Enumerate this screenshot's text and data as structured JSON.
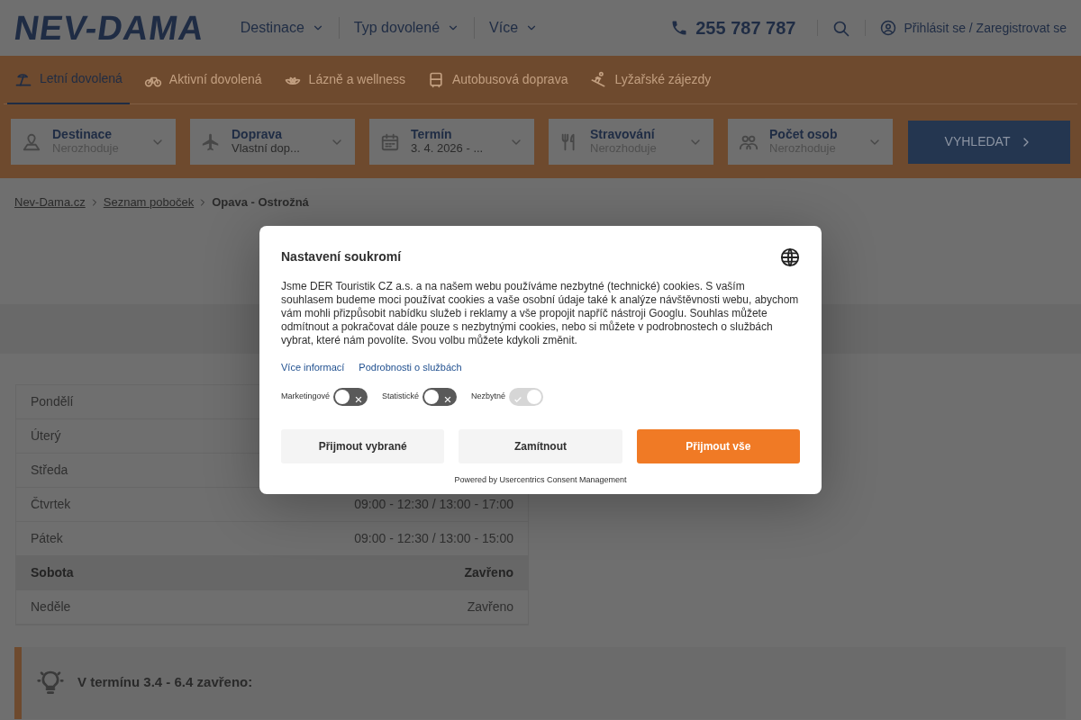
{
  "header": {
    "logo": "NEV-DAMA",
    "nav": [
      {
        "label": "Destinace"
      },
      {
        "label": "Typ dovolené"
      },
      {
        "label": "Více"
      }
    ],
    "phone": "255 787 787",
    "login": "Přihlásit se / Zaregistrovat se"
  },
  "category_tabs": [
    {
      "label": "Letní dovolená",
      "selected": true
    },
    {
      "label": "Aktivní dovolená",
      "selected": false
    },
    {
      "label": "Lázně a wellness",
      "selected": false
    },
    {
      "label": "Autobusová doprava",
      "selected": false
    },
    {
      "label": "Lyžařské zájezdy",
      "selected": false
    }
  ],
  "search_fields": [
    {
      "label": "Destinace",
      "placeholder": "Nerozhoduje"
    },
    {
      "label": "Doprava",
      "value": "Vlastní dop..."
    },
    {
      "label": "Termín",
      "value": "3. 4. 2026 - ..."
    },
    {
      "label": "Stravování",
      "placeholder": "Nerozhoduje"
    },
    {
      "label": "Počet osob",
      "placeholder": "Nerozhoduje"
    }
  ],
  "search_button": "VYHLEDAT",
  "breadcrumb": [
    {
      "label": "Nev-Dama.cz",
      "current": false
    },
    {
      "label": "Seznam poboček",
      "current": false
    },
    {
      "label": "Opava - Ostrožná",
      "current": true
    }
  ],
  "opening_hours": [
    {
      "day": "Pondělí",
      "highlighted": false
    },
    {
      "day": "Úterý",
      "highlighted": false
    },
    {
      "day": "Středa",
      "highlighted": false
    },
    {
      "day": "Čtvrtek",
      "hours": "09:00 - 12:30 / 13:00 - 17:00",
      "highlighted": false
    },
    {
      "day": "Pátek",
      "hours": "09:00 - 12:30 / 13:00 - 15:00",
      "highlighted": false
    },
    {
      "day": "Sobota",
      "hours": "Zavřeno",
      "highlighted": true
    },
    {
      "day": "Neděle",
      "hours": "Zavřeno",
      "highlighted": false
    }
  ],
  "notice": "V termínu 3.4 - 6.4 zavřeno:",
  "consent": {
    "title": "Nastavení soukromí",
    "text": "Jsme DER Touristik CZ a.s. a na našem webu používáme nezbytné (technické) cookies. S vaším souhlasem budeme moci používat cookies a vaše osobní údaje také k analýze návštěvnosti webu, abychom vám mohli přizpůsobit nabídku služeb i reklamy a vše propojit napříč nástroji Googlu. Souhlas můžete odmítnout a pokračovat dále pouze s nezbytnými cookies, nebo si můžete v podrobnostech o službách vybrat, které nám povolíte. Svou volbu můžete kdykoli změnit.",
    "links": [
      "Více informací",
      "Podrobnosti o službách"
    ],
    "toggles": [
      {
        "label": "Marketingové",
        "on": false,
        "disabled": false
      },
      {
        "label": "Statistické",
        "on": false,
        "disabled": false
      },
      {
        "label": "Nezbytné",
        "on": true,
        "disabled": true
      }
    ],
    "buttons": [
      {
        "label": "Přijmout vybrané",
        "kind": "secondary"
      },
      {
        "label": "Zamítnout",
        "kind": "secondary"
      },
      {
        "label": "Přijmout vše",
        "kind": "primary"
      }
    ],
    "powered_by": "Powered by Usercentrics Consent Management"
  }
}
